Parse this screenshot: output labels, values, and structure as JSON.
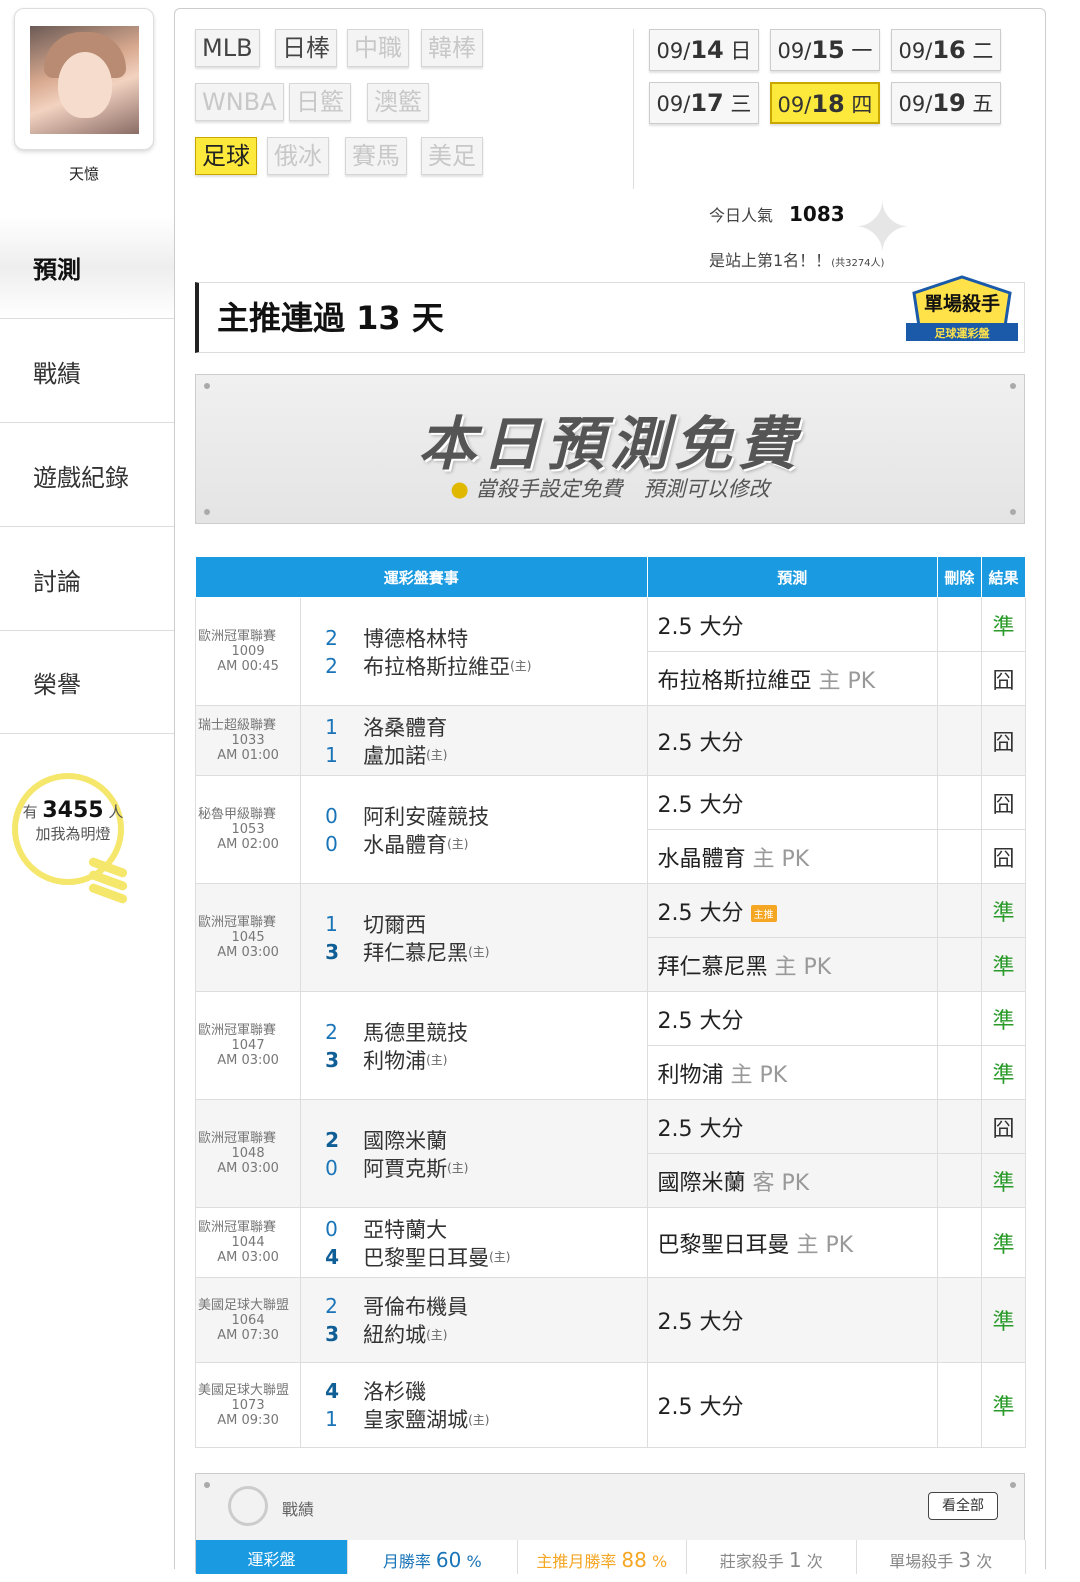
{
  "user": {
    "name": "天憶"
  },
  "nav": [
    {
      "label": "預測",
      "active": true
    },
    {
      "label": "戰績"
    },
    {
      "label": "遊戲紀錄"
    },
    {
      "label": "討論"
    },
    {
      "label": "榮譽"
    }
  ],
  "fans": {
    "prefix": "有",
    "count": "3455",
    "suffix": "人",
    "line2": "加我為明燈"
  },
  "sports": [
    {
      "label": "MLB",
      "state": "normal"
    },
    {
      "label": "日棒",
      "state": "normal"
    },
    {
      "label": "中職",
      "state": "disabled"
    },
    {
      "label": "韓棒",
      "state": "disabled"
    },
    {
      "label": "WNBA",
      "state": "disabled"
    },
    {
      "label": "日籃",
      "state": "disabled"
    },
    {
      "label": "澳籃",
      "state": "disabled"
    },
    {
      "label": "足球",
      "state": "active"
    },
    {
      "label": "俄冰",
      "state": "disabled"
    },
    {
      "label": "賽馬",
      "state": "disabled"
    },
    {
      "label": "美足",
      "state": "disabled"
    }
  ],
  "dates": [
    {
      "md": "09/",
      "d": "14",
      "wd": "日"
    },
    {
      "md": "09/",
      "d": "15",
      "wd": "一"
    },
    {
      "md": "09/",
      "d": "16",
      "wd": "二"
    },
    {
      "md": "09/",
      "d": "17",
      "wd": "三"
    },
    {
      "md": "09/",
      "d": "18",
      "wd": "四",
      "active": true
    },
    {
      "md": "09/",
      "d": "19",
      "wd": "五"
    }
  ],
  "popularity": {
    "label": "今日人氣",
    "value": "1083"
  },
  "rank": {
    "text": "是站上第1名！！",
    "note": "(共3274人)"
  },
  "streak": {
    "text": "主推連過 13 天"
  },
  "badge": {
    "title": "單場殺手",
    "sub": "足球運彩盤"
  },
  "free": {
    "title": "本日預測免費",
    "sub": "當殺手設定免費　預測可以修改"
  },
  "table": {
    "headers": {
      "match": "運彩盤賽事",
      "pred": "預測",
      "del": "刪除",
      "result": "結果"
    },
    "home_mark": "(主)",
    "zhu_label": "主推",
    "games": [
      {
        "league": "歐洲冠軍聯賽",
        "no": "1009",
        "time": "AM 00:45",
        "a": {
          "s": "2",
          "n": "博德格林特"
        },
        "h": {
          "s": "2",
          "n": "布拉格斯拉維亞"
        },
        "preds": [
          {
            "t": "2.5 大分",
            "r": "準"
          },
          {
            "t": "布拉格斯拉維亞",
            "side": "主 PK",
            "r": "囧"
          }
        ]
      },
      {
        "league": "瑞士超級聯賽",
        "no": "1033",
        "time": "AM 01:00",
        "a": {
          "s": "1",
          "n": "洛桑體育"
        },
        "h": {
          "s": "1",
          "n": "盧加諾"
        },
        "preds": [
          {
            "t": "2.5 大分",
            "r": "囧"
          }
        ]
      },
      {
        "league": "秘魯甲級聯賽",
        "no": "1053",
        "time": "AM 02:00",
        "a": {
          "s": "0",
          "n": "阿利安薩競技"
        },
        "h": {
          "s": "0",
          "n": "水晶體育"
        },
        "preds": [
          {
            "t": "2.5 大分",
            "r": "囧"
          },
          {
            "t": "水晶體育",
            "side": "主 PK",
            "r": "囧"
          }
        ]
      },
      {
        "league": "歐洲冠軍聯賽",
        "no": "1045",
        "time": "AM 03:00",
        "a": {
          "s": "1",
          "n": "切爾西"
        },
        "h": {
          "s": "3",
          "n": "拜仁慕尼黑",
          "win": true
        },
        "preds": [
          {
            "t": "2.5 大分",
            "zhu": true,
            "r": "準"
          },
          {
            "t": "拜仁慕尼黑",
            "side": "主 PK",
            "r": "準"
          }
        ]
      },
      {
        "league": "歐洲冠軍聯賽",
        "no": "1047",
        "time": "AM 03:00",
        "a": {
          "s": "2",
          "n": "馬德里競技"
        },
        "h": {
          "s": "3",
          "n": "利物浦",
          "win": true
        },
        "preds": [
          {
            "t": "2.5 大分",
            "r": "準"
          },
          {
            "t": "利物浦",
            "side": "主 PK",
            "r": "準"
          }
        ]
      },
      {
        "league": "歐洲冠軍聯賽",
        "no": "1048",
        "time": "AM 03:00",
        "a": {
          "s": "2",
          "n": "國際米蘭",
          "win": true
        },
        "h": {
          "s": "0",
          "n": "阿賈克斯"
        },
        "preds": [
          {
            "t": "2.5 大分",
            "r": "囧"
          },
          {
            "t": "國際米蘭",
            "side": "客 PK",
            "r": "準"
          }
        ]
      },
      {
        "league": "歐洲冠軍聯賽",
        "no": "1044",
        "time": "AM 03:00",
        "a": {
          "s": "0",
          "n": "亞特蘭大"
        },
        "h": {
          "s": "4",
          "n": "巴黎聖日耳曼",
          "win": true
        },
        "preds": [
          {
            "t": "巴黎聖日耳曼",
            "side": "主 PK",
            "r": "準"
          }
        ]
      },
      {
        "league": "美國足球大聯盟",
        "no": "1064",
        "time": "AM 07:30",
        "a": {
          "s": "2",
          "n": "哥倫布機員"
        },
        "h": {
          "s": "3",
          "n": "紐約城",
          "win": true
        },
        "preds": [
          {
            "t": "2.5 大分",
            "r": "準"
          }
        ]
      },
      {
        "league": "美國足球大聯盟",
        "no": "1073",
        "time": "AM 09:30",
        "a": {
          "s": "4",
          "n": "洛杉磯",
          "win": true
        },
        "h": {
          "s": "1",
          "n": "皇家鹽湖城"
        },
        "preds": [
          {
            "t": "2.5 大分",
            "r": "準"
          }
        ]
      }
    ]
  },
  "stats": {
    "title": "戰績",
    "view_all": "看全部",
    "tabs": [
      {
        "label": "運彩盤"
      },
      {
        "label": "月勝率",
        "value": "60",
        "unit": "%"
      },
      {
        "label": "主推月勝率",
        "value": "88",
        "unit": "%"
      },
      {
        "label": "莊家殺手",
        "value": "1",
        "unit": "次"
      },
      {
        "label": "單場殺手",
        "value": "3",
        "unit": "次"
      }
    ]
  },
  "colors": {
    "accent": "#1a9ae0",
    "highlight": "#fde93b",
    "win": "#2a9a2a"
  }
}
